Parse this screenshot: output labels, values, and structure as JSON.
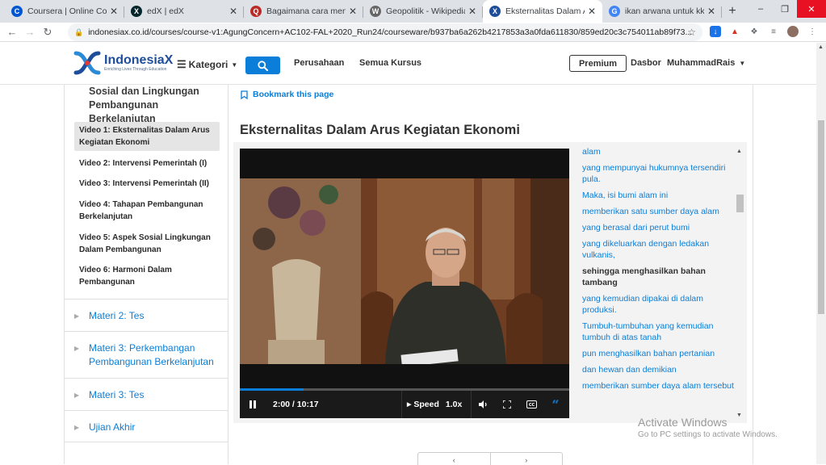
{
  "browser": {
    "tabs": [
      {
        "title": "Coursera | Online Courses",
        "icon": "coursera-icon",
        "color": "#0056d2",
        "glyph": "C",
        "active": false
      },
      {
        "title": "edX | edX",
        "icon": "edx-icon",
        "color": "#02262b",
        "glyph": "X",
        "active": false
      },
      {
        "title": "Bagaimana cara mendapatkan",
        "icon": "quora-icon",
        "color": "#b92b27",
        "glyph": "Q",
        "active": false
      },
      {
        "title": "Geopolitik - Wikipedia bahasa",
        "icon": "wikipedia-icon",
        "color": "#666666",
        "glyph": "W",
        "active": false
      },
      {
        "title": "Eksternalitas Dalam Arus",
        "icon": "indonesiax-icon",
        "color": "#1e4e9a",
        "glyph": "X",
        "active": true
      },
      {
        "title": "ikan arwana untuk kkesehatan",
        "icon": "google-icon",
        "color": "#4285f4",
        "glyph": "G",
        "active": false
      }
    ],
    "url": "indonesiax.co.id/courses/course-v1:AgungConcern+AC102-FAL+2020_Run24/courseware/b937ba6a262b4217853a3a0fda611830/859ed20c3c754011ab89f73..."
  },
  "header": {
    "brand": "IndonesiaX",
    "tagline": "Enriching Lives Through Education",
    "kategori": "Kategori",
    "perusahaan": "Perusahaan",
    "semua_kursus": "Semua Kursus",
    "premium": "Premium",
    "dasbor": "Dasbor",
    "user": "MuhammadRais",
    "accent": "#0a7ed8"
  },
  "sidebar": {
    "section_title": "Sosial dan Lingkungan Pembangunan Berkelanjutan",
    "units": [
      "Video 1: Eksternalitas Dalam Arus Kegiatan Ekonomi",
      "Video 2: Intervensi Pemerintah (I)",
      "Video 3: Intervensi Pemerintah (II)",
      "Video 4: Tahapan Pembangunan Berkelanjutan",
      "Video 5: Aspek Sosial Lingkungan Dalam Pembangunan",
      "Video 6: Harmoni Dalam Pembangunan"
    ],
    "subsections": [
      "Materi 2: Tes",
      "Materi 3: Perkembangan Pembangunan Berkelanjutan",
      "Materi 3: Tes",
      "Ujian Akhir"
    ]
  },
  "content": {
    "bookmark": "Bookmark this page",
    "title": "Eksternalitas Dalam Arus Kegiatan Ekonomi",
    "video": {
      "time": "2:00 / 10:17",
      "speed_label": "Speed",
      "speed_value": "1.0x",
      "progress": 0.194
    },
    "transcript": [
      "alam",
      "yang mempunyai hukumnya tersendiri pula.",
      "Maka, isi bumi alam ini",
      "memberikan satu sumber daya alam",
      "yang berasal dari perut bumi",
      "yang dikeluarkan dengan ledakan vulkanis,",
      "sehingga menghasilkan bahan tambang",
      "yang kemudian dipakai di dalam produksi.",
      "Tumbuh-tumbuhan yang kemudian tumbuh di atas tanah",
      "pun menghasilkan bahan pertanian",
      "dan hewan dan demikian",
      "memberikan sumber daya alam tersebut"
    ],
    "current_line": 6
  },
  "watermark": {
    "line1": "Activate Windows",
    "line2": "Go to PC settings to activate Windows."
  }
}
